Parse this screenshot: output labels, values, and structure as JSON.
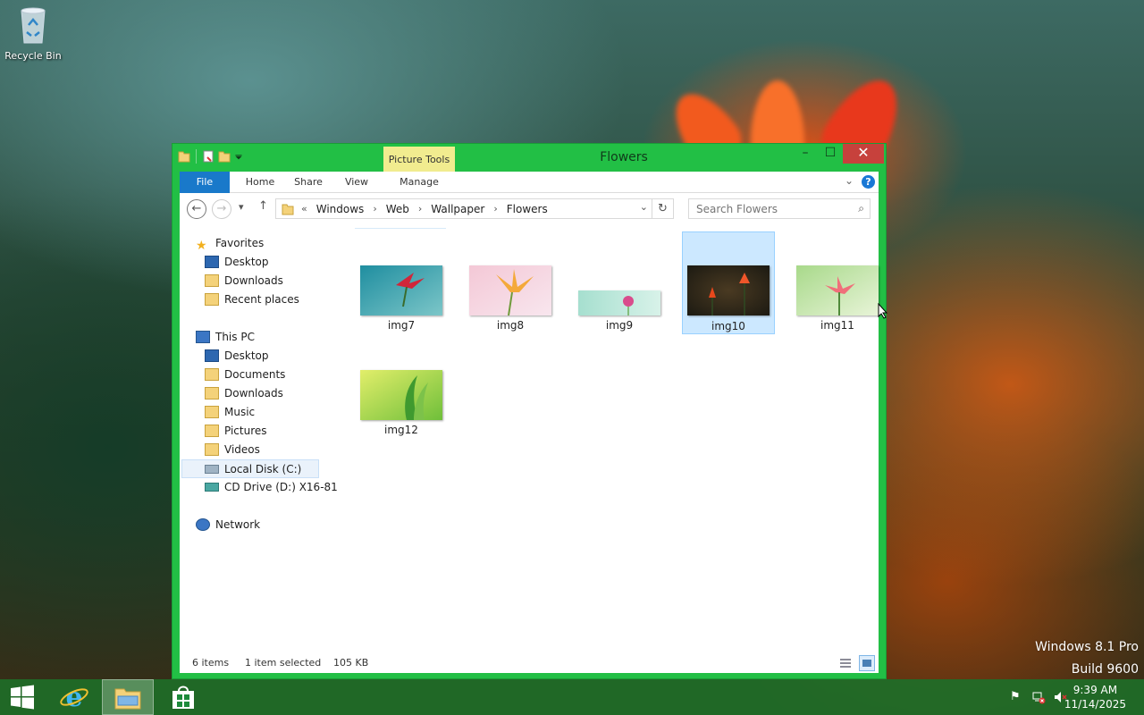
{
  "desktop": {
    "recycle_bin_label": "Recycle Bin",
    "watermark_line1": "Windows 8.1 Pro",
    "watermark_line2": "Build 9600"
  },
  "window": {
    "title": "Flowers",
    "contextual_tab_group": "Picture Tools",
    "controls": {
      "minimize": "–",
      "maximize": "☐",
      "close": "✕"
    },
    "ribbon_tabs": [
      {
        "label": "File"
      },
      {
        "label": "Home"
      },
      {
        "label": "Share"
      },
      {
        "label": "View"
      },
      {
        "label": "Manage"
      }
    ],
    "help_label": "?",
    "address": {
      "overflow": "«",
      "crumbs": [
        "Windows",
        "Web",
        "Wallpaper",
        "Flowers"
      ]
    },
    "search_placeholder": "Search Flowers",
    "nav_pane": {
      "favorites_header": "Favorites",
      "favorites": [
        "Desktop",
        "Downloads",
        "Recent places"
      ],
      "this_pc_header": "This PC",
      "this_pc_items": [
        "Desktop",
        "Documents",
        "Downloads",
        "Music",
        "Pictures",
        "Videos",
        "Local Disk (C:)",
        "CD Drive (D:) X16-81"
      ],
      "network_header": "Network"
    },
    "files": [
      {
        "name": "img7",
        "selected": false
      },
      {
        "name": "img8",
        "selected": false
      },
      {
        "name": "img9",
        "selected": false
      },
      {
        "name": "img10",
        "selected": true
      },
      {
        "name": "img11",
        "selected": false
      },
      {
        "name": "img12",
        "selected": false
      }
    ],
    "status": {
      "item_count": "6 items",
      "selection": "1 item selected",
      "size": "105 KB"
    }
  },
  "taskbar": {
    "clock_time": "9:39 AM",
    "clock_date": "11/14/2025"
  },
  "colors": {
    "window_frame": "#22bf45",
    "file_tab": "#1979ca",
    "picture_tools": "#f1ec8f",
    "close_button": "#c7413c",
    "selection": "#cce8ff"
  }
}
